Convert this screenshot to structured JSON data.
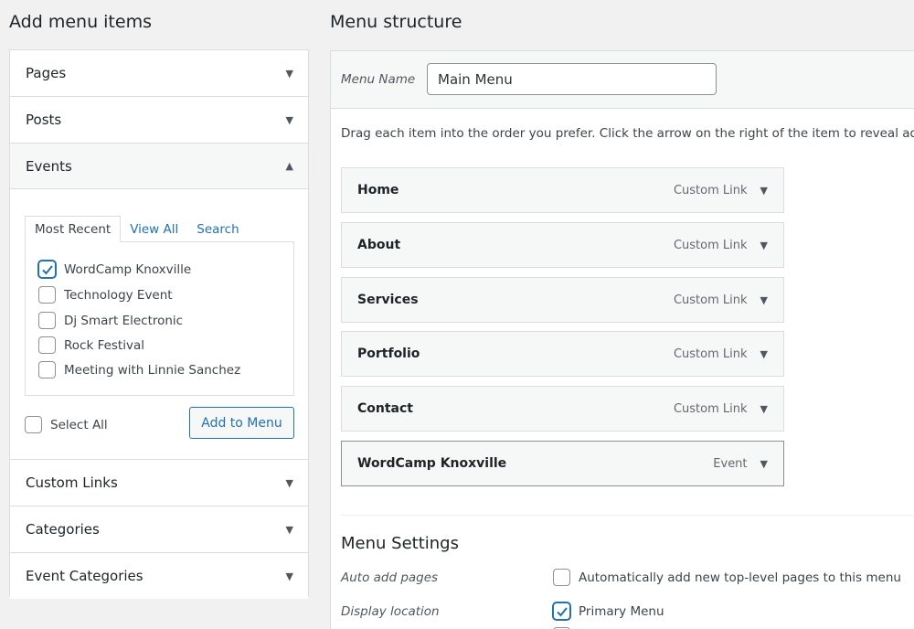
{
  "left": {
    "heading": "Add menu items",
    "sections": {
      "pages": "Pages",
      "posts": "Posts",
      "events": "Events",
      "custom_links": "Custom Links",
      "categories": "Categories",
      "event_categories": "Event Categories"
    },
    "tabs": {
      "most_recent": "Most Recent",
      "view_all": "View All",
      "search": "Search"
    },
    "events": [
      {
        "label": "WordCamp Knoxville",
        "checked": true
      },
      {
        "label": "Technology Event",
        "checked": false
      },
      {
        "label": "Dj Smart Electronic",
        "checked": false
      },
      {
        "label": "Rock Festival",
        "checked": false
      },
      {
        "label": "Meeting with Linnie Sanchez",
        "checked": false
      }
    ],
    "select_all": "Select All",
    "add_button": "Add to Menu"
  },
  "right": {
    "heading": "Menu structure",
    "menu_name_label": "Menu Name",
    "menu_name_value": "Main Menu",
    "instructions": "Drag each item into the order you prefer. Click the arrow on the right of the item to reveal add",
    "items": [
      {
        "title": "Home",
        "type": "Custom Link"
      },
      {
        "title": "About",
        "type": "Custom Link"
      },
      {
        "title": "Services",
        "type": "Custom Link"
      },
      {
        "title": "Portfolio",
        "type": "Custom Link"
      },
      {
        "title": "Contact",
        "type": "Custom Link"
      },
      {
        "title": "WordCamp Knoxville",
        "type": "Event"
      }
    ],
    "settings": {
      "title": "Menu Settings",
      "auto_add_label": "Auto add pages",
      "auto_add_option": "Automatically add new top-level pages to this menu",
      "display_location_label": "Display location",
      "primary_menu_option": "Primary Menu"
    }
  },
  "icons": {
    "arrow_down": "▼",
    "arrow_up": "▲"
  },
  "colors": {
    "accent": "#2271b1",
    "border": "#dcdcde"
  }
}
